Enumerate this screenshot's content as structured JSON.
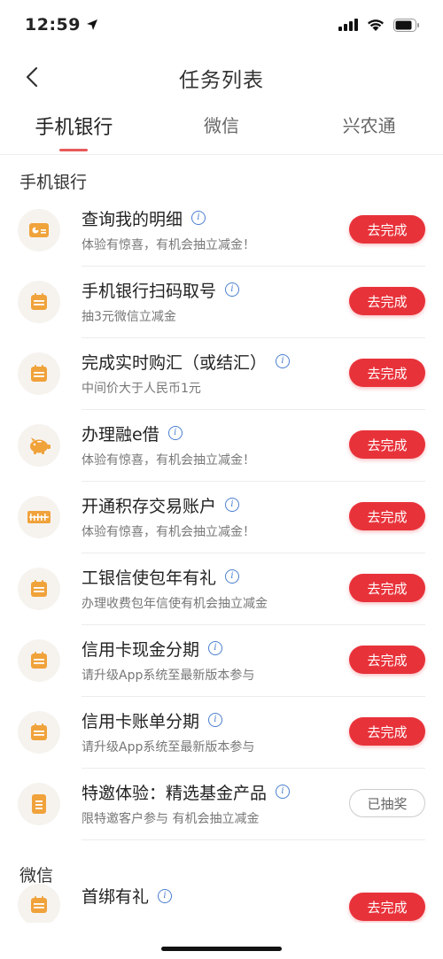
{
  "status": {
    "time": "12:59"
  },
  "nav": {
    "title": "任务列表"
  },
  "tabs": [
    {
      "label": "手机银行"
    },
    {
      "label": "微信"
    },
    {
      "label": "兴农通"
    }
  ],
  "sections": [
    {
      "title": "手机银行"
    },
    {
      "title": "微信"
    }
  ],
  "tasks": [
    {
      "name": "查询我的明细",
      "desc": "体验有惊喜，有机会抽立减金！",
      "action": "去完成",
      "icon": "card-icon"
    },
    {
      "name": "手机银行扫码取号",
      "desc": "抽3元微信立减金",
      "action": "去完成",
      "icon": "calendar-icon"
    },
    {
      "name": "完成实时购汇（或结汇）",
      "desc": "中间价大于人民币1元",
      "action": "去完成",
      "icon": "calendar-icon"
    },
    {
      "name": "办理融e借",
      "desc": "体验有惊喜，有机会抽立减金！",
      "action": "去完成",
      "icon": "piggy-bank-icon"
    },
    {
      "name": "开通积存交易账户",
      "desc": "体验有惊喜，有机会抽立减金！",
      "action": "去完成",
      "icon": "ruler-icon"
    },
    {
      "name": "工银信使包年有礼",
      "desc": "办理收费包年信使有机会抽立减金",
      "action": "去完成",
      "icon": "calendar-icon"
    },
    {
      "name": "信用卡现金分期",
      "desc": "请升级App系统至最新版本参与",
      "action": "去完成",
      "icon": "calendar-icon"
    },
    {
      "name": "信用卡账单分期",
      "desc": "请升级App系统至最新版本参与",
      "action": "去完成",
      "icon": "calendar-icon"
    },
    {
      "name": "特邀体验：精选基金产品",
      "desc": "限特邀客户参与 有机会抽立减金",
      "action": "已抽奖",
      "icon": "document-icon"
    }
  ],
  "wechat_tasks": [
    {
      "name": "首绑有礼",
      "action": "去完成",
      "icon": "calendar-icon"
    }
  ],
  "colors": {
    "accent": "#e8323a",
    "icon": "#f0a23b",
    "info": "#4a7fd0"
  }
}
